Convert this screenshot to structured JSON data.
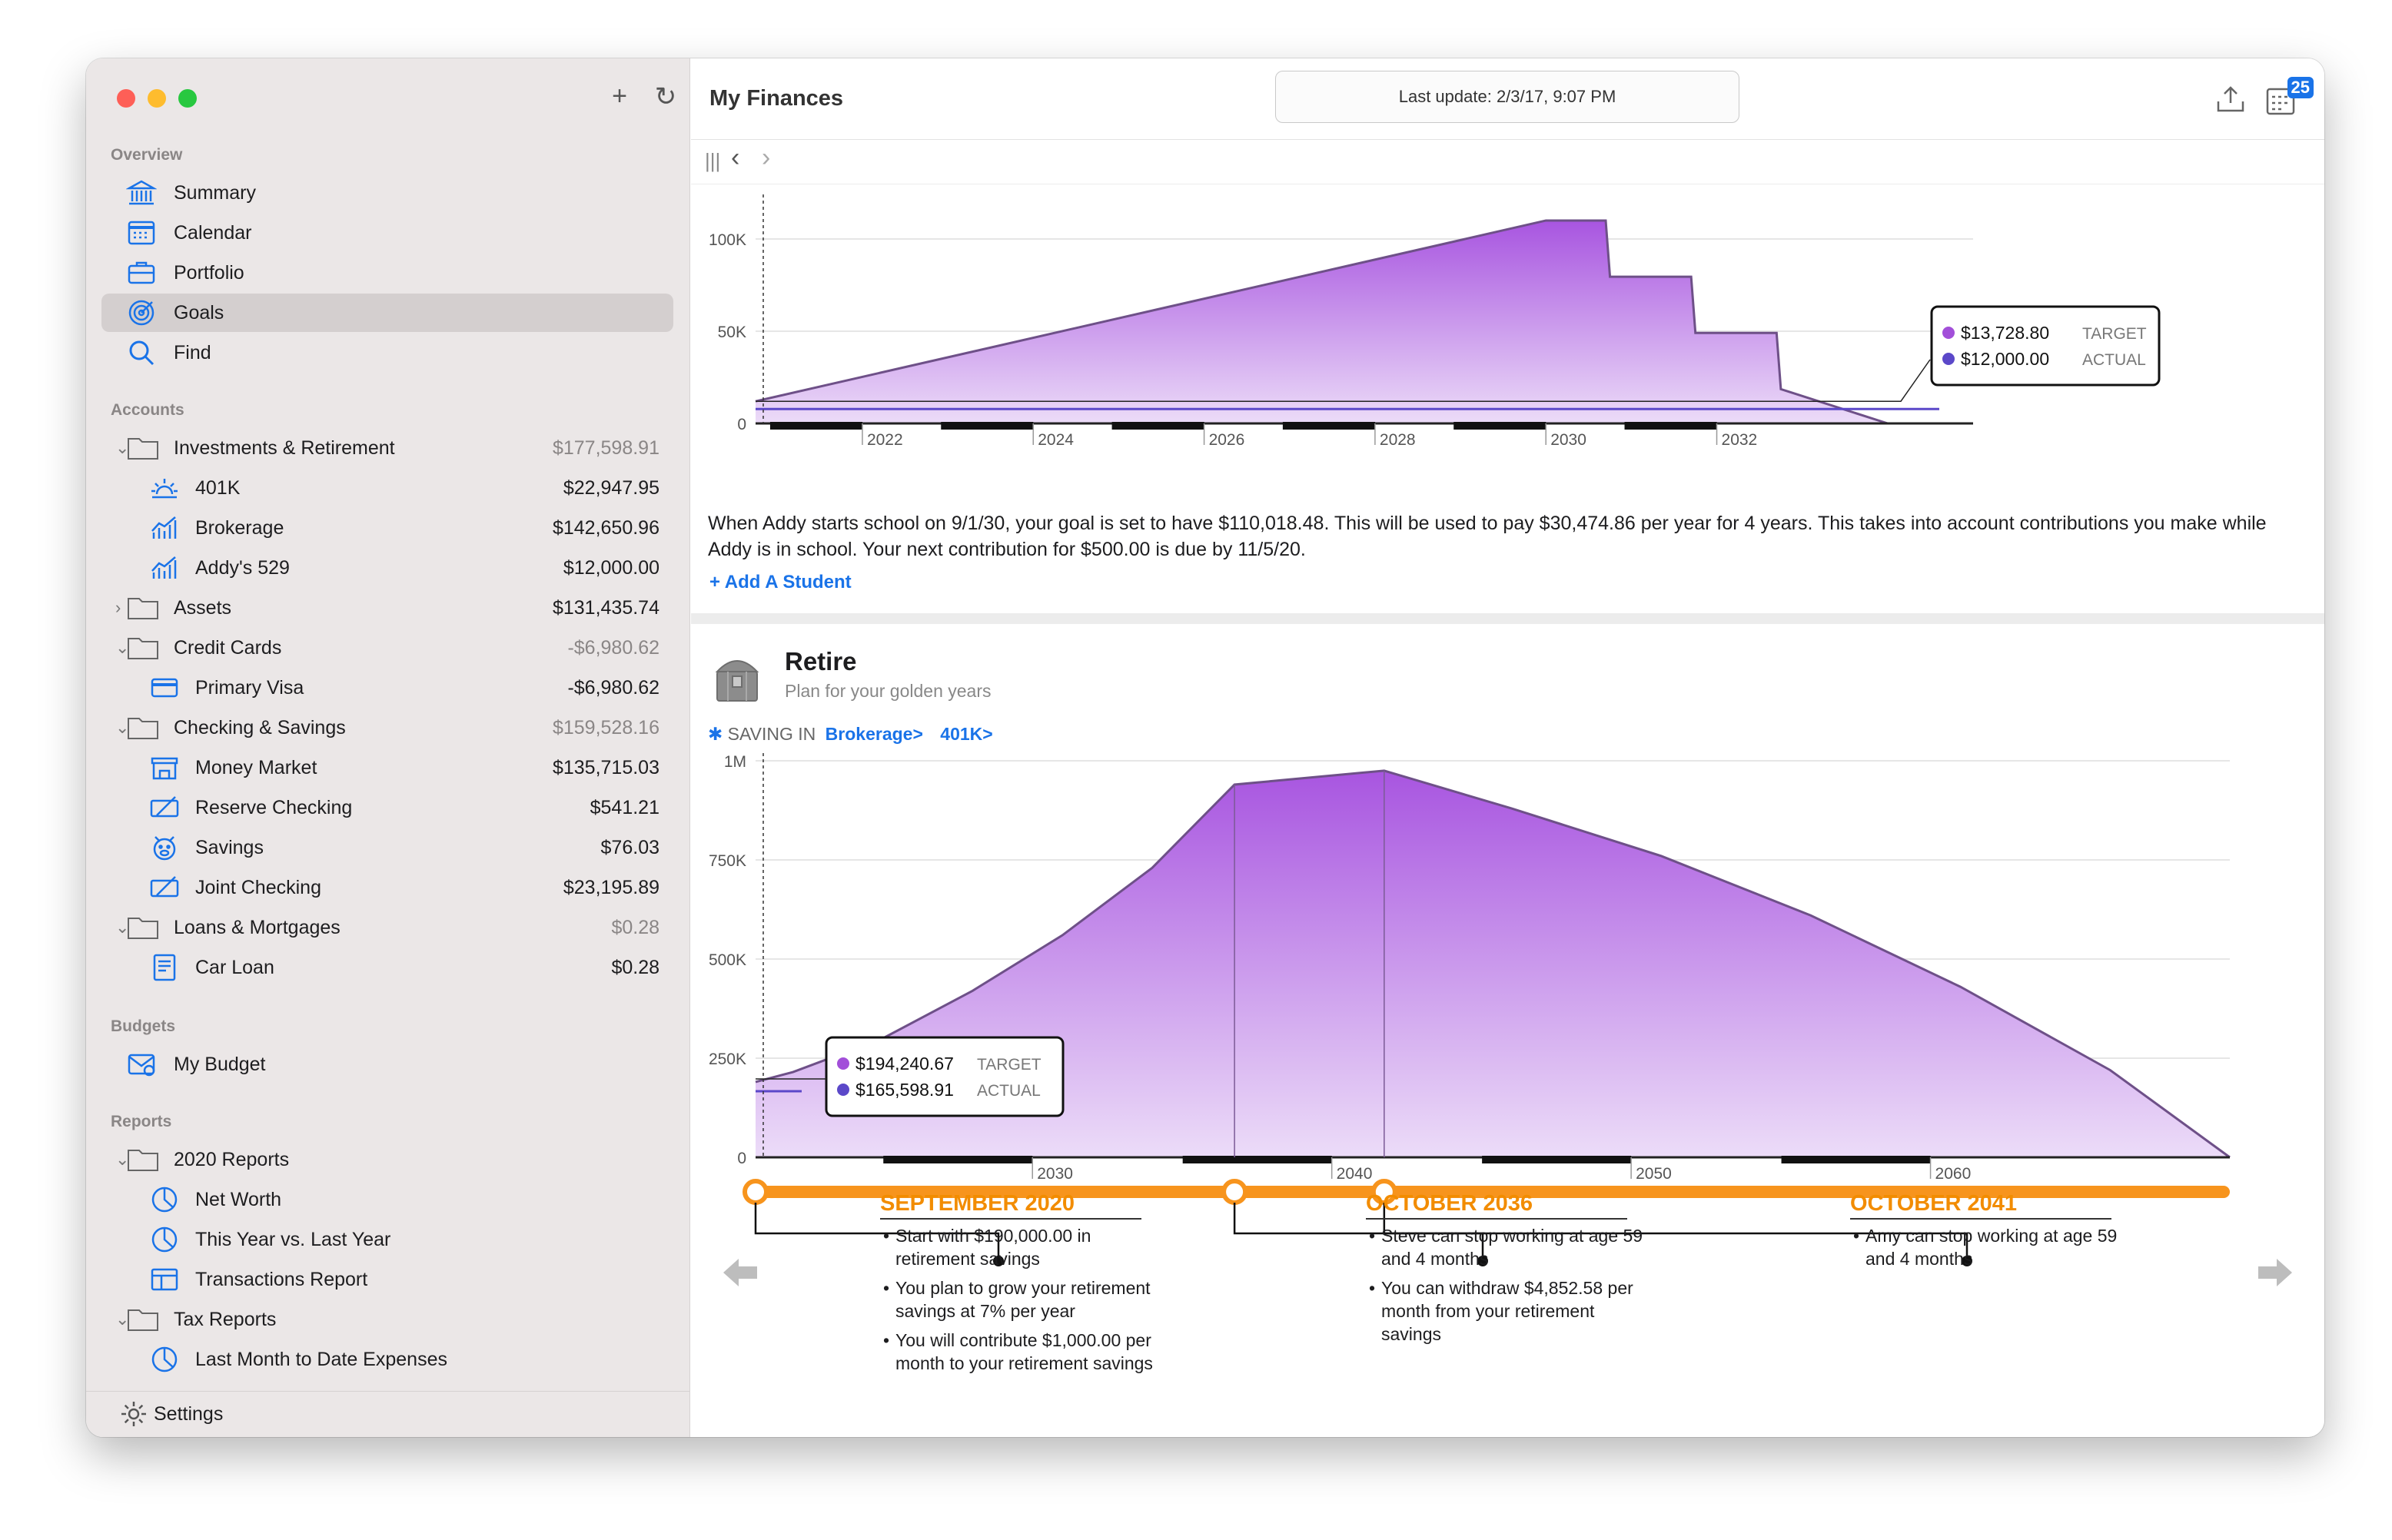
{
  "sidebar": {
    "sections": {
      "overview": "Overview",
      "accounts": "Accounts",
      "budgets": "Budgets",
      "reports": "Reports"
    },
    "overview_items": [
      {
        "label": "Summary",
        "icon": "bank-icon"
      },
      {
        "label": "Calendar",
        "icon": "calendar-icon"
      },
      {
        "label": "Portfolio",
        "icon": "briefcase-icon"
      },
      {
        "label": "Goals",
        "icon": "target-icon"
      },
      {
        "label": "Find",
        "icon": "search-icon"
      }
    ],
    "accounts": [
      {
        "label": "Investments & Retirement",
        "amount": "$177,598.91"
      },
      {
        "label": "401K",
        "amount": "$22,947.95"
      },
      {
        "label": "Brokerage",
        "amount": "$142,650.96"
      },
      {
        "label": "Addy's 529",
        "amount": "$12,000.00"
      },
      {
        "label": "Assets",
        "amount": "$131,435.74"
      },
      {
        "label": "Credit Cards",
        "amount": "-$6,980.62"
      },
      {
        "label": "Primary Visa",
        "amount": "-$6,980.62"
      },
      {
        "label": "Checking & Savings",
        "amount": "$159,528.16"
      },
      {
        "label": "Money Market",
        "amount": "$135,715.03"
      },
      {
        "label": "Reserve Checking",
        "amount": "$541.21"
      },
      {
        "label": "Savings",
        "amount": "$76.03"
      },
      {
        "label": "Joint Checking",
        "amount": "$23,195.89"
      },
      {
        "label": "Loans & Mortgages",
        "amount": "$0.28"
      },
      {
        "label": "Car Loan",
        "amount": "$0.28"
      }
    ],
    "budgets": [
      {
        "label": "My Budget"
      }
    ],
    "reports": [
      {
        "label": "2020 Reports"
      },
      {
        "label": "Net Worth"
      },
      {
        "label": "This Year vs. Last Year"
      },
      {
        "label": "Transactions Report"
      },
      {
        "label": "Tax Reports"
      },
      {
        "label": "Last Month to Date Expenses"
      }
    ],
    "settings_label": "Settings",
    "add_symbol": "+",
    "refresh_symbol": "↻"
  },
  "main": {
    "title": "My Finances",
    "last_update": "Last update: 2/3/17, 9:07 PM",
    "calendar_badge": "25",
    "nav": {
      "grip": "|||",
      "back": "‹",
      "forward": "›"
    },
    "education": {
      "paragraph": "When Addy starts school on 9/1/30, your goal is set to have $110,018.48. This will be used to pay $30,474.86 per year for 4 years. This takes into account contributions you make while Addy is in school. Your next contribution for $500.00 is due by 11/5/20.",
      "add_student": "+ Add A Student",
      "tooltip": {
        "target_value": "$13,728.80",
        "target_label": "TARGET",
        "actual_value": "$12,000.00",
        "actual_label": "ACTUAL"
      }
    },
    "retire": {
      "title": "Retire",
      "subtitle": "Plan for your golden years",
      "saving_in": "SAVING IN",
      "accounts": [
        "Brokerage>",
        "401K>"
      ],
      "tooltip": {
        "target_value": "$194,240.67",
        "target_label": "TARGET",
        "actual_value": "$165,598.91",
        "actual_label": "ACTUAL"
      },
      "milestones": [
        {
          "title": "SEPTEMBER 2020",
          "bullets": [
            "Start with $190,000.00 in retirement savings",
            "You plan to grow your retirement savings at 7% per year",
            "You will contribute $1,000.00 per month to your retirement savings"
          ]
        },
        {
          "title": "OCTOBER 2036",
          "bullets": [
            "Steve can stop working at age 59 and 4 months",
            "You can withdraw $4,852.58 per month from your retirement savings"
          ]
        },
        {
          "title": "OCTOBER 2041",
          "bullets": [
            "Amy can stop working at age 59 and 4 months"
          ]
        }
      ]
    }
  },
  "colors": {
    "accent": "#1a73e8",
    "chart_fill_top": "#a855e0",
    "chart_fill_bottom": "#ecdcf8",
    "timeline": "#f7941d",
    "milestone_title": "#f28c00"
  },
  "chart_data": [
    {
      "type": "area",
      "title": "",
      "xlabel": "",
      "ylabel": "",
      "x_ticks": [
        "2022",
        "2024",
        "2026",
        "2028",
        "2030",
        "2032"
      ],
      "y_ticks": [
        "0",
        "50K",
        "100K"
      ],
      "xlim": [
        2020.75,
        2035.0
      ],
      "ylim": [
        0,
        120000
      ],
      "x": [
        2020.75,
        2030.0,
        2030.7,
        2030.75,
        2031.7,
        2031.75,
        2032.7,
        2032.75,
        2034.0
      ],
      "y": [
        12000,
        110018,
        110018,
        79544,
        79544,
        49070,
        49070,
        18596,
        0
      ],
      "legend": [
        "TARGET",
        "ACTUAL"
      ]
    },
    {
      "type": "area",
      "title": "",
      "xlabel": "",
      "ylabel": "",
      "x_ticks": [
        "2030",
        "2040",
        "2050",
        "2060"
      ],
      "y_ticks": [
        "0",
        "250K",
        "500K",
        "750K",
        "1M"
      ],
      "xlim": [
        2020.75,
        2070
      ],
      "ylim": [
        0,
        1000000
      ],
      "x": [
        2020.75,
        2022,
        2025,
        2028,
        2031,
        2034,
        2036.75,
        2041.75,
        2046,
        2051,
        2056,
        2061,
        2066,
        2070
      ],
      "y": [
        190000,
        215000,
        300000,
        420000,
        560000,
        730000,
        940000,
        975000,
        880000,
        760000,
        610000,
        430000,
        220000,
        0
      ],
      "legend": [
        "TARGET",
        "ACTUAL"
      ]
    }
  ]
}
